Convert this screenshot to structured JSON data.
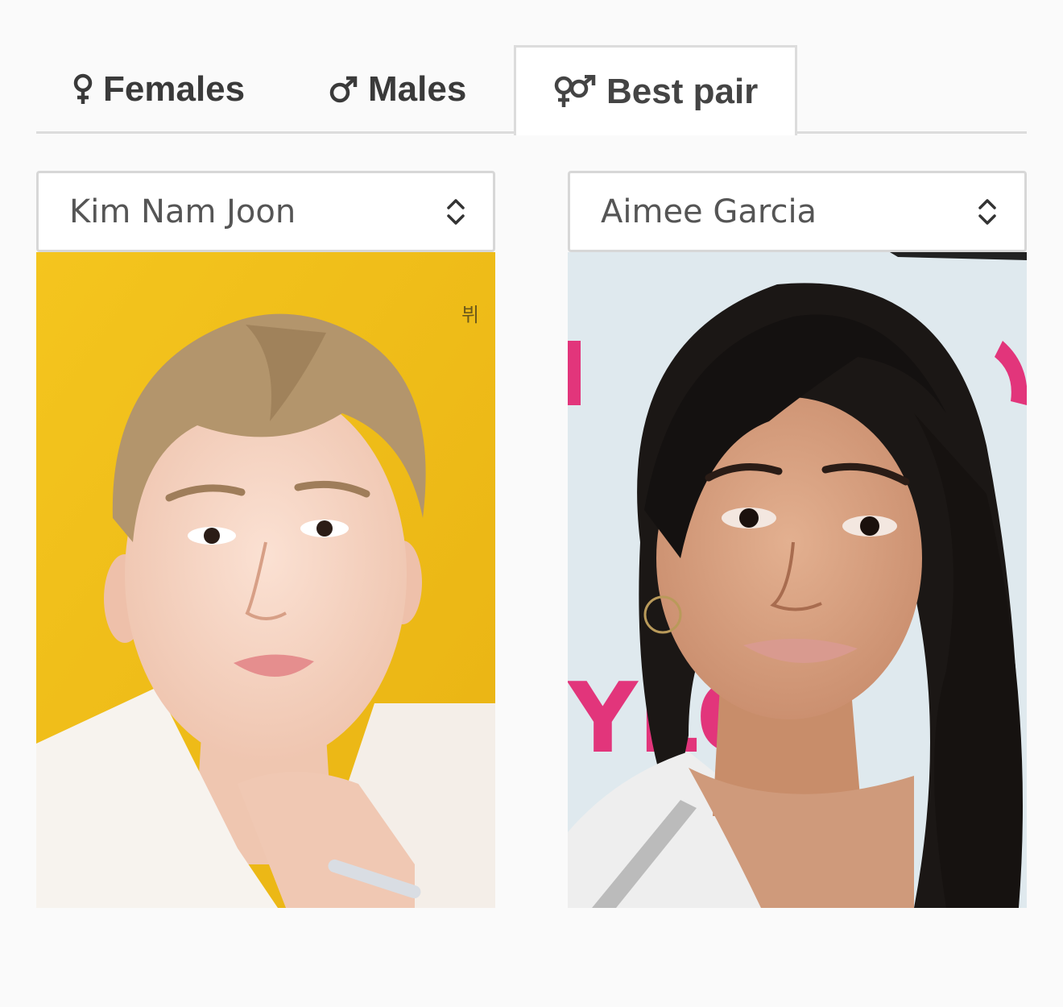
{
  "tabs": [
    {
      "label": "Females",
      "icon": "female-symbol-icon",
      "active": false
    },
    {
      "label": "Males",
      "icon": "male-symbol-icon",
      "active": false
    },
    {
      "label": "Best pair",
      "icon": "couple-symbol-icon",
      "active": true
    }
  ],
  "left_picker": {
    "selected": "Kim Nam Joon",
    "icon": "up-down-chevron-icon"
  },
  "right_picker": {
    "selected": "Aimee Garcia",
    "icon": "up-down-chevron-icon"
  },
  "photos": {
    "left": {
      "backdrop_color": "#f2c21c"
    },
    "right": {
      "backdrop_color": "#dce8ee",
      "accent_color": "#e2357b"
    }
  },
  "colors": {
    "page_bg": "#fafafa",
    "tab_border": "#dcdcdc",
    "active_tab_bg": "#ffffff",
    "text": "#3a3a3a"
  }
}
